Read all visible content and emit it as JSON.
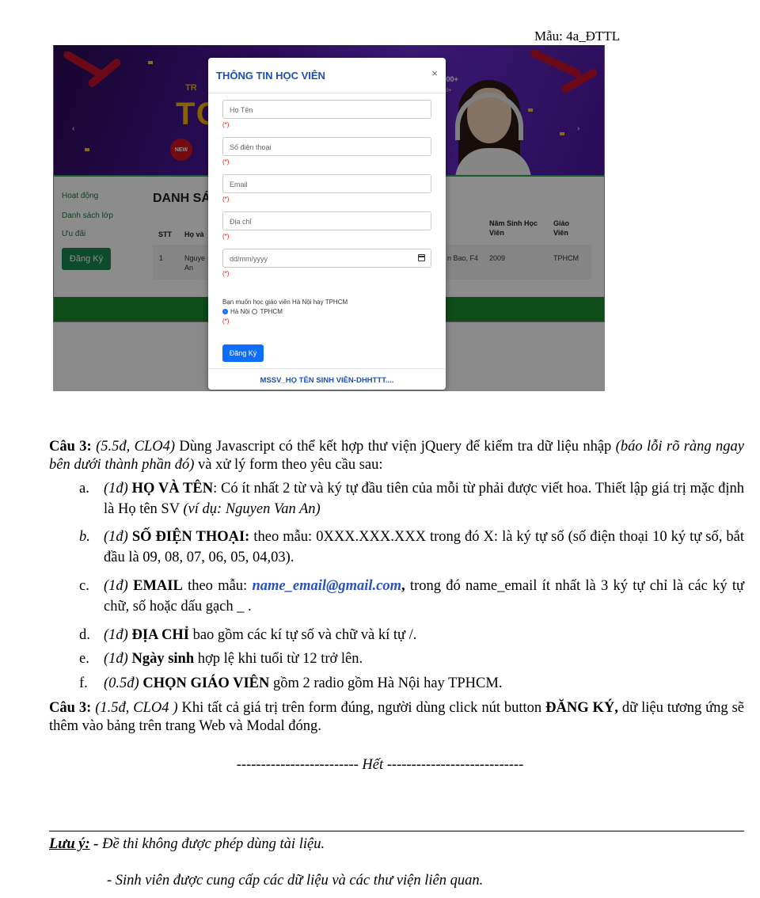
{
  "header": {
    "form_code": "Mẫu: 4a_ĐTTL"
  },
  "screenshot": {
    "banner": {
      "tr": "TR",
      "big": "TOI",
      "new_badge": "NEW",
      "toeic": "EIC 900+",
      "toeic_small": "EIC 650+"
    },
    "sidebar": {
      "items": [
        "Hoạt động",
        "Danh sách lớp",
        "Ưu đãi"
      ],
      "register_button": "Đăng Ký"
    },
    "list": {
      "title": "DANH SÁ",
      "columns": [
        "STT",
        "Họ và",
        "Năm Sinh Học Viên",
        "Giáo Viên"
      ],
      "rows": [
        {
          "stt": "1",
          "name": "Nguye An",
          "address": "n Bao, F4",
          "year": "2009",
          "teacher": "TPHCM"
        }
      ]
    },
    "modal": {
      "title": "THÔNG TIN HỌC VIÊN",
      "close": "×",
      "fields": [
        {
          "placeholder": "Họ Tên",
          "required": "(*)"
        },
        {
          "placeholder": "Số điện thoại",
          "required": "(*)"
        },
        {
          "placeholder": "Email",
          "required": "(*)"
        },
        {
          "placeholder": "Địa chỉ",
          "required": "(*)"
        },
        {
          "placeholder": "dd/mm/yyyy",
          "required": "(*)"
        }
      ],
      "teacher_question": "Bạn muốn học giáo viên Hà Nội hay TPHCM",
      "radio_options": [
        {
          "label": "Hà Nội",
          "checked": true
        },
        {
          "label": "TPHCM",
          "checked": false
        }
      ],
      "radio_required": "(*)",
      "submit": "Đăng Ký",
      "footer": "MSSV_HỌ TÊN SINH VIÊN-DHHTTT...."
    }
  },
  "question3": {
    "label": "Câu 3:",
    "meta": "(5.5đ, CLO4)",
    "text1": " Dùng Javascript có thể kết hợp thư viện jQuery để kiểm tra dữ liệu nhập ",
    "italic": "(báo lỗi rõ ràng ngay bên dưới thành phần đó)",
    "text2": " và xử lý form theo yêu cầu sau:",
    "items": [
      {
        "letter": "a.",
        "points": "(1đ)",
        "bold": "HỌ VÀ TÊN",
        "text": ": Có ít nhất 2 từ và ký tự đầu tiên của mỗi từ phải được viết hoa. Thiết lập giá trị mặc định là Họ tên SV ",
        "example": "(ví dụ: Nguyen Van An)"
      },
      {
        "letter": "b.",
        "points": "(1đ)",
        "bold": "SỐ ĐIỆN THOẠI:",
        "text": " theo mẫu: 0XXX.XXX.XXX trong đó X: là ký tự số (số điện thoại 10 ký tự số, bắt đầu là 09, 08, 07, 06, 05, 04,03)."
      },
      {
        "letter": "c.",
        "points": "(1đ)",
        "bold": "EMAIL",
        "text": " theo mẫu: ",
        "email": "name_email@gmail.com",
        "comma": ",",
        "text2": " trong đó name_email ít nhất là 3 ký tự chỉ là các ký tự chữ, số hoặc dấu gạch _ ."
      },
      {
        "letter": "d.",
        "points": "(1đ)",
        "bold": "ĐỊA CHỈ",
        "text": " bao gồm các kí tự số và chữ và kí tự /."
      },
      {
        "letter": "e.",
        "points": "(1đ)",
        "bold": "Ngày sinh",
        "text": " hợp lệ khi tuổi từ 12 trở lên."
      },
      {
        "letter": "f.",
        "points": "(0.5đ)",
        "bold": "CHỌN GIÁO VIÊN",
        "text": "  gồm 2 radio gồm Hà Nội hay TPHCM."
      }
    ]
  },
  "question3b": {
    "label": "Câu 3:",
    "meta": "(1.5đ, CLO4 )",
    "text1": " Khi tất cả giá trị trên form đúng, người dùng click nút button ",
    "bold": "ĐĂNG KÝ,",
    "text2": " dữ liệu tương ứng sẽ thêm vào bảng trên trang Web và Modal đóng."
  },
  "end": {
    "left": "------------------------- ",
    "word": "Hết",
    "right": " ----------------------------"
  },
  "notes": {
    "label": "Lưu ý:",
    "dash": " - ",
    "line1": "Đề thi không được phép dùng tài liệu.",
    "line2": "- Sinh viên được cung cấp các dữ liệu và các thư viện liên quan."
  }
}
